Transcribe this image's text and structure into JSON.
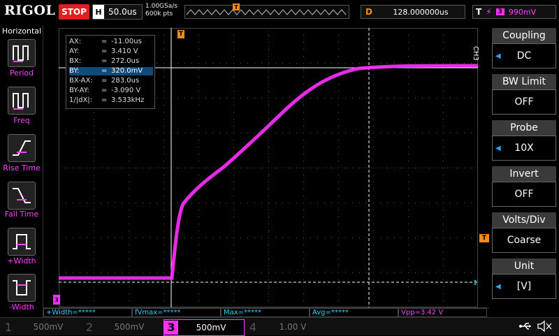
{
  "brand": "RIGOL",
  "run_state": "STOP",
  "timebase": {
    "tag": "H",
    "value": "50.0us"
  },
  "sampling": {
    "rate": "1.00GSa/s",
    "points": "600k pts"
  },
  "delay": {
    "tag": "D",
    "value": "128.000000us"
  },
  "trigger": {
    "tag": "T",
    "source": "3",
    "level": "990mV",
    "marker": "T"
  },
  "left_menu": {
    "title": "Horizontal",
    "items": [
      {
        "label": "Period"
      },
      {
        "label": "Freq"
      },
      {
        "label": "Rise Time"
      },
      {
        "label": "Fall Time"
      },
      {
        "label": "+Width"
      },
      {
        "label": "-Width"
      }
    ]
  },
  "cursor_readout": [
    {
      "key": "AX:",
      "eq": "=",
      "value": "-11.00us"
    },
    {
      "key": "AY:",
      "eq": "=",
      "value": "3.410 V"
    },
    {
      "key": "BX:",
      "eq": "=",
      "value": "272.0us"
    },
    {
      "key": "BY:",
      "eq": "=",
      "value": "320.0mV"
    },
    {
      "key": "BX-AX:",
      "eq": "=",
      "value": "283.0us"
    },
    {
      "key": "BY-AY:",
      "eq": "=",
      "value": "-3.090 V"
    },
    {
      "key": "1/|dX|:",
      "eq": "=",
      "value": "3.533kHz"
    }
  ],
  "right_menu": {
    "channel": "CH3",
    "items": [
      {
        "title": "Coupling",
        "value": "DC"
      },
      {
        "title": "BW Limit",
        "value": "OFF"
      },
      {
        "title": "Probe",
        "value": "10X"
      },
      {
        "title": "Invert",
        "value": "OFF"
      },
      {
        "title": "Volts/Div",
        "value": "Coarse"
      },
      {
        "title": "Unit",
        "value": "[V]"
      }
    ]
  },
  "measurements": [
    "+Width=*****",
    "fVmax=*****",
    "Max=*****",
    "Avg=*****",
    "Vpp=3.42 V"
  ],
  "channels": [
    {
      "num": "1",
      "scale": "500mV"
    },
    {
      "num": "2",
      "scale": "500mV"
    },
    {
      "num": "3",
      "scale": "500mV"
    },
    {
      "num": "4",
      "scale": "1.00 V"
    }
  ],
  "ch3_marker": "3",
  "colors": {
    "ch3": "#ff30ff",
    "trigger": "#f28a1c",
    "cursor": "#ffffff",
    "measure": "#2fd1ff"
  }
}
